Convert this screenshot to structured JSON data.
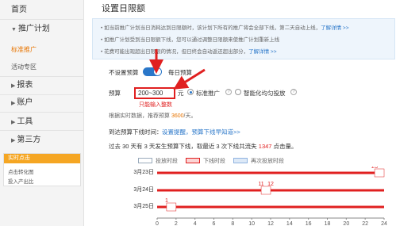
{
  "sidebar": {
    "home": "首页",
    "promo_plan": "推广计划",
    "sub_items": [
      "标准推广",
      "活动专区"
    ],
    "report": "报表",
    "account": "账户",
    "tools": "工具",
    "third": "第三方",
    "sim": {
      "title": "实时点击",
      "links": [
        "点击转化图",
        "投入产出比"
      ]
    }
  },
  "page_title": "设置日限额",
  "tips": [
    {
      "text": "如当前推广计划当日消耗达到日限额时，该计划下所有的推广将会全部下线，第二天自动上线，",
      "link": "了解详情 >>"
    },
    {
      "text": "如推广计划受到当日限额下线，您可以通过调整日限额来使推广计划重新上线",
      "link": ""
    },
    {
      "text": "花费可能出现超出日限额的情况，但日终会自动返还超出部分，",
      "link": "了解详情 >>"
    }
  ],
  "no_budget_label": "不设置预算",
  "daily_budget_label": "每日预算",
  "budget_label": "预算",
  "budget_value": "200~300",
  "budget_unit": "元",
  "modes": [
    "标准推广",
    "智能化均匀投放"
  ],
  "int_only": "只能输入整数",
  "suggest": {
    "prefix": "根据实时数据，推荐预算 ",
    "value": "3600",
    "suffix": "/天。"
  },
  "offline": {
    "label": "到达预算下线时间：",
    "links": "设置提醒，预算下线早知道>>"
  },
  "stat": {
    "prefix": "过去 30 天有 3 天发生预算下线，取最近 3 次下线共流失 ",
    "value": "1347",
    "suffix": " 点击量。"
  },
  "legend": [
    "投放时段",
    "下线时段",
    "再次投放时段"
  ],
  "colors": {
    "accent": "#2a77c9",
    "alert": "#e02020",
    "orange": "#f5a623"
  },
  "chart_data": {
    "type": "timeline",
    "x": [
      0,
      2,
      4,
      6,
      8,
      10,
      12,
      14,
      16,
      18,
      20,
      22,
      24
    ],
    "rows": [
      {
        "date": "3月23日",
        "offline_label": "23",
        "offline_start": 23,
        "offline_end": 24
      },
      {
        "date": "3月24日",
        "offline_label": "11",
        "offline_start": 11,
        "offline_end": 12,
        "resume_label": "12"
      },
      {
        "date": "3月25日",
        "offline_label": "1",
        "offline_start": 1,
        "offline_end": 2
      }
    ]
  }
}
